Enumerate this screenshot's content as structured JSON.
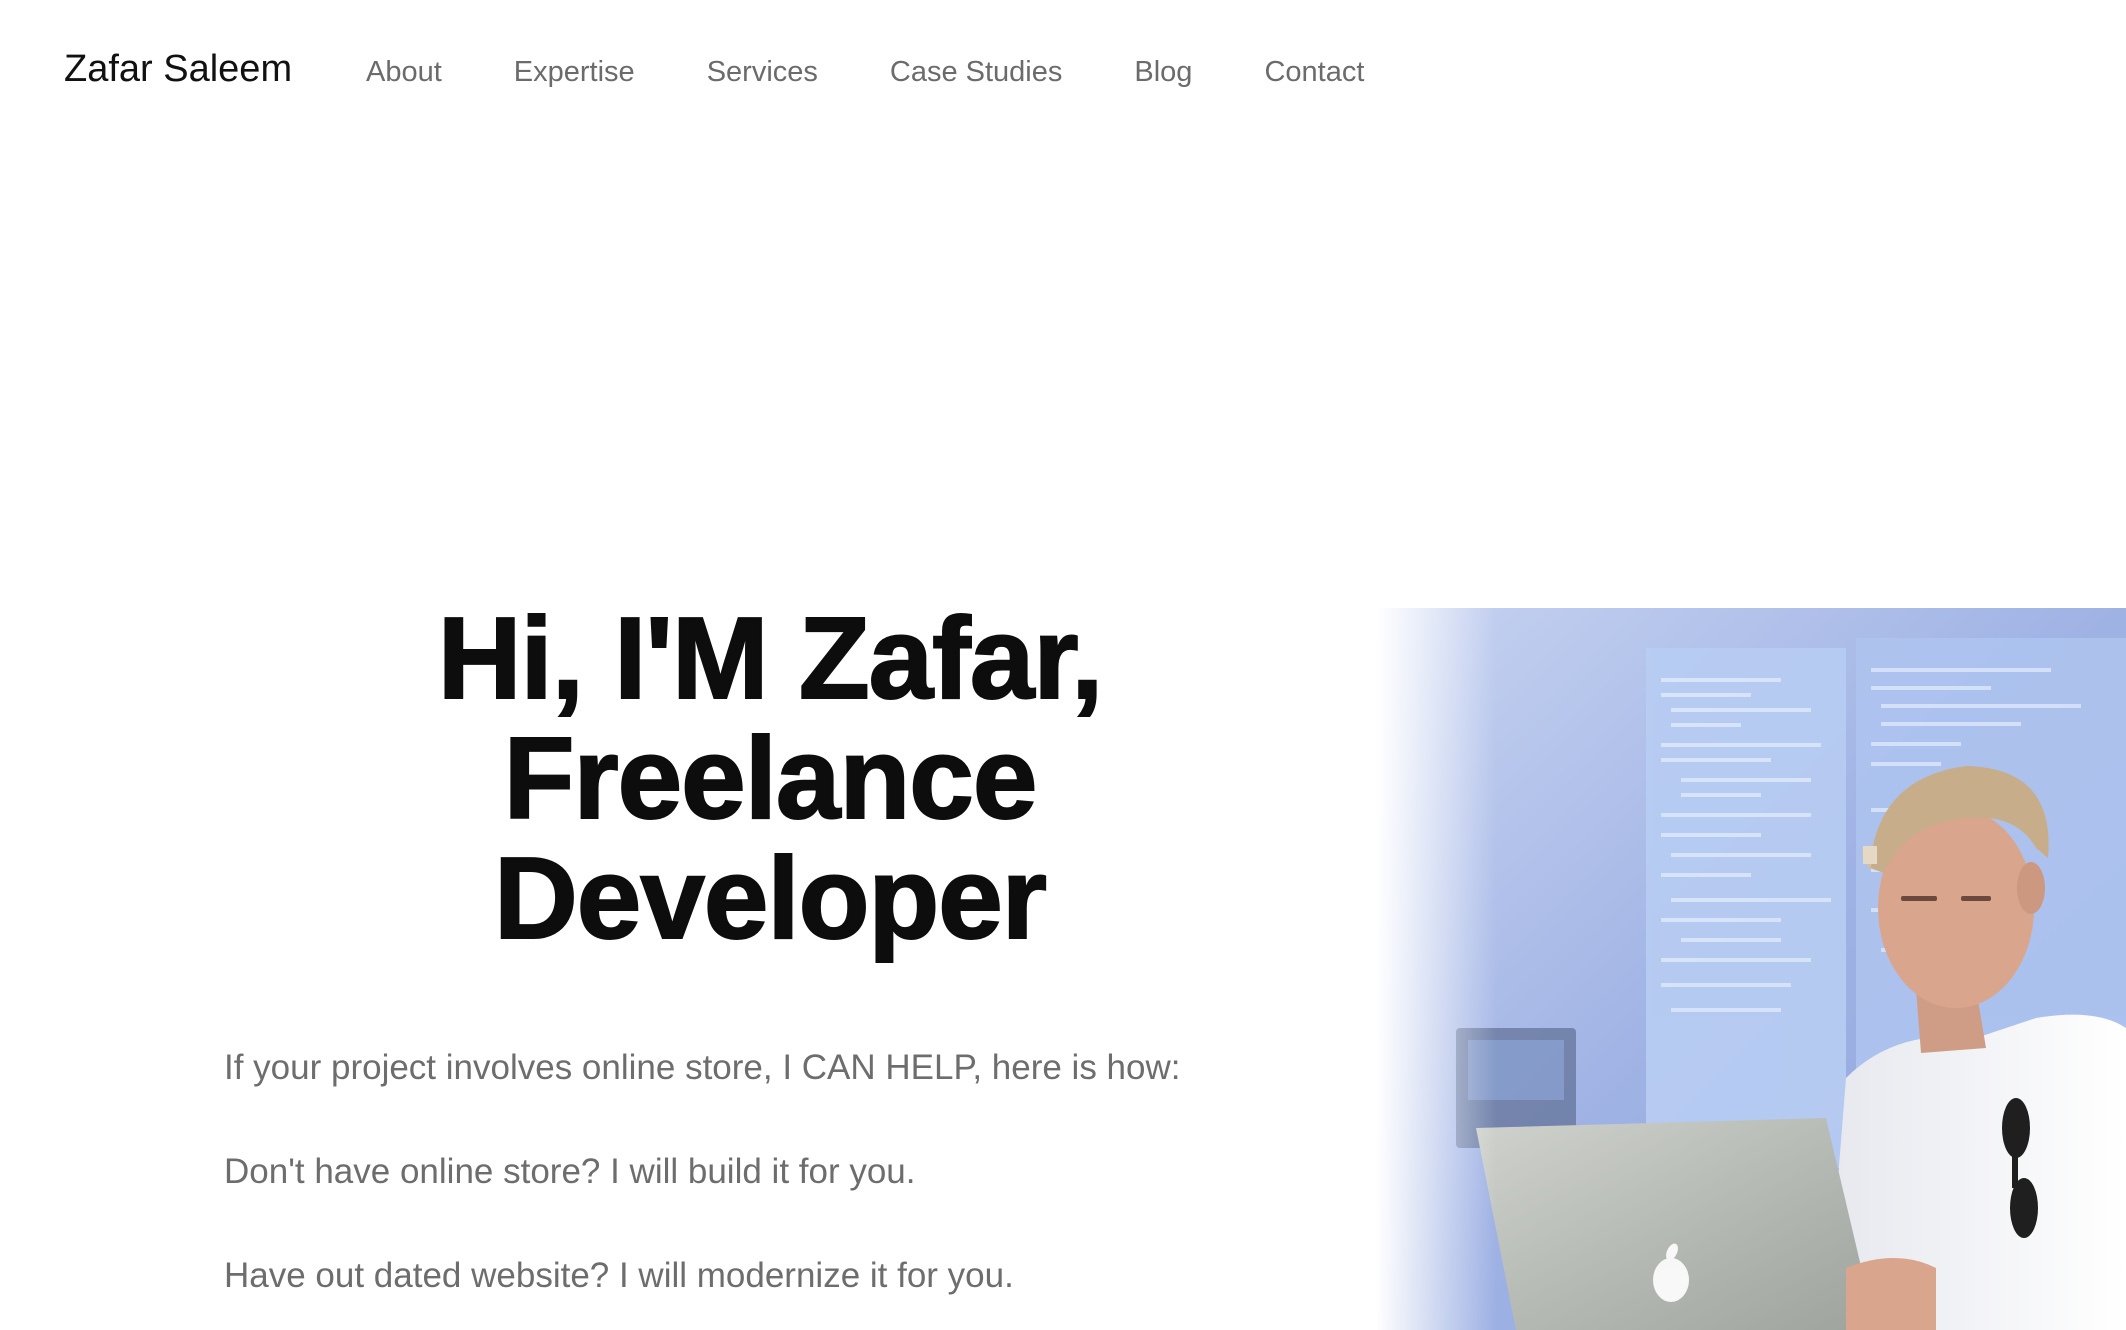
{
  "brand": {
    "name": "Zafar Saleem"
  },
  "nav": {
    "items": [
      {
        "label": "About"
      },
      {
        "label": "Expertise"
      },
      {
        "label": "Services"
      },
      {
        "label": "Case Studies"
      },
      {
        "label": "Blog"
      },
      {
        "label": "Contact"
      }
    ]
  },
  "hero": {
    "title_lines": [
      "Hi, I'M Zafar,",
      "Freelance",
      "Developer"
    ],
    "lines": [
      "If your project involves online store, I CAN HELP, here is how:",
      "Don't have online store? I will build it for you.",
      "Have out dated website? I will modernize it for you."
    ],
    "photo": {
      "icon": "developer-photo",
      "colors": {
        "wall": "#9fb3e6",
        "screen": "#cfe0f7",
        "cap": "#c7ad8a",
        "shirt": "#f2f2f2",
        "laptop": "#b8bcb8",
        "skin": "#d9a58d"
      }
    }
  },
  "colors": {
    "background": "#ffffff",
    "heading": "#0d0d0d",
    "nav_text": "#6b6b6b",
    "body_text": "#6d6d6d"
  }
}
